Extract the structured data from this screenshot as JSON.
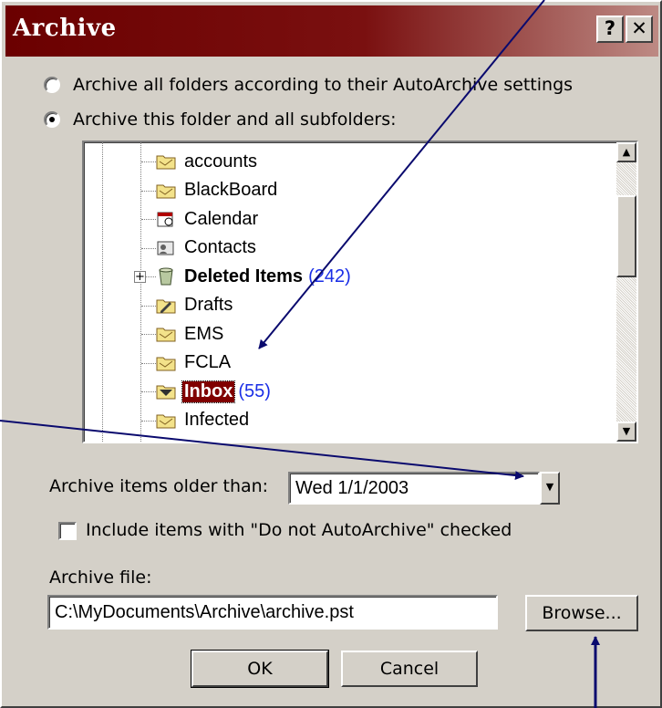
{
  "window": {
    "title": "Archive",
    "help_button": "?",
    "close_button": "✕"
  },
  "options": {
    "archive_all_label": "Archive all folders according to their AutoArchive settings",
    "archive_all_selected": false,
    "archive_this_label": "Archive this folder and all subfolders:",
    "archive_this_selected": true
  },
  "folder_tree": {
    "items": [
      {
        "label": "accounts",
        "icon": "folder-icon"
      },
      {
        "label": "BlackBoard",
        "icon": "folder-icon"
      },
      {
        "label": "Calendar",
        "icon": "calendar-icon"
      },
      {
        "label": "Contacts",
        "icon": "contacts-icon"
      },
      {
        "label": "Deleted Items",
        "count": "(242)",
        "icon": "deleted-items-icon",
        "bold": true,
        "expandable": true
      },
      {
        "label": "Drafts",
        "icon": "drafts-icon"
      },
      {
        "label": "EMS",
        "icon": "folder-icon"
      },
      {
        "label": "FCLA",
        "icon": "folder-icon"
      },
      {
        "label": "Inbox",
        "count": "(55)",
        "icon": "inbox-icon",
        "selected": true
      },
      {
        "label": "Infected",
        "icon": "folder-icon"
      }
    ],
    "expander_symbol": "+"
  },
  "older_than": {
    "label": "Archive items older than:",
    "value": "Wed 1/1/2003"
  },
  "include_checkbox": {
    "label": "Include items with \"Do not AutoArchive\" checked",
    "checked": false
  },
  "archive_file": {
    "label": "Archive file:",
    "value": "C:\\MyDocuments\\Archive\\archive.pst",
    "browse_label": "Browse..."
  },
  "buttons": {
    "ok_label": "OK",
    "cancel_label": "Cancel"
  },
  "colors": {
    "titlebar": "#800000",
    "selection": "#800000",
    "count_text": "#1a2ee6",
    "annotation_arrow": "#0a0a6e"
  }
}
